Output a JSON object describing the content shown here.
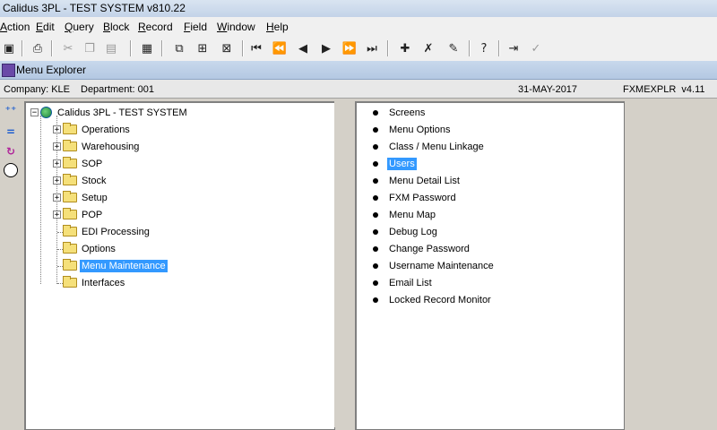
{
  "window": {
    "title": "Calidus 3PL - TEST SYSTEM v810.22"
  },
  "menubar": [
    {
      "pre": "",
      "u": "A",
      "post": "ction",
      "full": "Action"
    },
    {
      "pre": "",
      "u": "E",
      "post": "dit",
      "full": "Edit"
    },
    {
      "pre": "",
      "u": "Q",
      "post": "uery",
      "full": "Query"
    },
    {
      "pre": "",
      "u": "B",
      "post": "lock",
      "full": "Block"
    },
    {
      "pre": "",
      "u": "R",
      "post": "ecord",
      "full": "Record"
    },
    {
      "pre": "",
      "u": "F",
      "post": "ield",
      "full": "Field"
    },
    {
      "pre": "",
      "u": "W",
      "post": "indow",
      "full": "Window"
    },
    {
      "pre": "",
      "u": "H",
      "post": "elp",
      "full": "Help"
    }
  ],
  "subwindow": {
    "title": "Menu Explorer"
  },
  "info": {
    "company": "Company: KLE",
    "department": "Department: 001",
    "date": "31-MAY-2017",
    "form": "FXMEXPLR  v4.11"
  },
  "tree": {
    "root": "Calidus 3PL - TEST SYSTEM",
    "nodes": [
      {
        "label": "Operations",
        "expandable": true
      },
      {
        "label": "Warehousing",
        "expandable": true
      },
      {
        "label": "SOP",
        "expandable": true
      },
      {
        "label": "Stock",
        "expandable": true
      },
      {
        "label": "Setup",
        "expandable": true
      },
      {
        "label": "POP",
        "expandable": true
      },
      {
        "label": "EDI Processing",
        "expandable": false
      },
      {
        "label": "Options",
        "expandable": false
      },
      {
        "label": "Menu Maintenance",
        "expandable": false,
        "selected": true
      },
      {
        "label": "Interfaces",
        "expandable": false
      }
    ]
  },
  "items": [
    {
      "label": "Screens"
    },
    {
      "label": "Menu Options"
    },
    {
      "label": "Class / Menu Linkage"
    },
    {
      "label": "Users",
      "selected": true
    },
    {
      "label": "Menu Detail List"
    },
    {
      "label": "FXM Password"
    },
    {
      "label": "Menu Map"
    },
    {
      "label": "Debug Log"
    },
    {
      "label": "Change Password"
    },
    {
      "label": "Username Maintenance"
    },
    {
      "label": "Email List"
    },
    {
      "label": "Locked Record Monitor"
    }
  ],
  "colors": {
    "selection": "#3399ff"
  }
}
